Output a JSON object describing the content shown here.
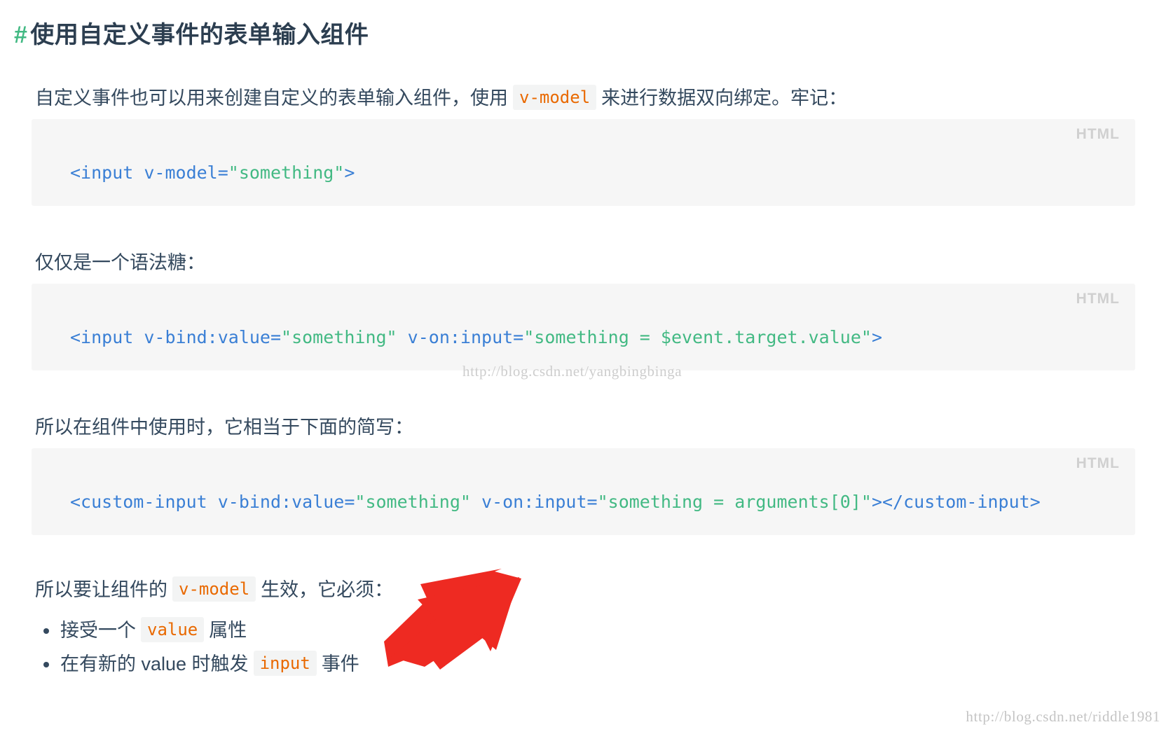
{
  "heading": {
    "anchor": "#",
    "text": "使用自定义事件的表单输入组件"
  },
  "paragraphs": {
    "p1_before": "自定义事件也可以用来创建自定义的表单输入组件，使用",
    "p1_code": "v-model",
    "p1_after": "来进行数据双向绑定。牢记：",
    "p2": "仅仅是一个语法糖：",
    "p3": "所以在组件中使用时，它相当于下面的简写：",
    "p4_before": "所以要让组件的",
    "p4_code": "v-model",
    "p4_after": "生效，它必须："
  },
  "code_blocks": [
    {
      "lang_label": "HTML",
      "tokens": [
        {
          "t": "<input",
          "c": "tag"
        },
        {
          "t": " v-model=",
          "c": "attr"
        },
        {
          "t": "\"something\"",
          "c": "str"
        },
        {
          "t": ">",
          "c": "tag"
        }
      ],
      "plain": "<input v-model=\"something\">"
    },
    {
      "lang_label": "HTML",
      "tokens": [
        {
          "t": "<input",
          "c": "tag"
        },
        {
          "t": " v-bind:value=",
          "c": "attr"
        },
        {
          "t": "\"something\"",
          "c": "str"
        },
        {
          "t": " v-on:input=",
          "c": "attr"
        },
        {
          "t": "\"something = $event.target.value\"",
          "c": "str"
        },
        {
          "t": ">",
          "c": "tag"
        }
      ],
      "plain": "<input v-bind:value=\"something\" v-on:input=\"something = $event.target.value\">"
    },
    {
      "lang_label": "HTML",
      "tokens": [
        {
          "t": "<custom-input",
          "c": "tag"
        },
        {
          "t": " v-bind:value=",
          "c": "attr"
        },
        {
          "t": "\"something\"",
          "c": "str"
        },
        {
          "t": " v-on:input=",
          "c": "attr"
        },
        {
          "t": "\"something = arguments[0]\"",
          "c": "str"
        },
        {
          "t": "></custom-input>",
          "c": "tag"
        }
      ],
      "plain": "<custom-input v-bind:value=\"something\" v-on:input=\"something = arguments[0]\"></custom-input>"
    }
  ],
  "bullets": [
    {
      "before": "接受一个",
      "code": "value",
      "after": "属性"
    },
    {
      "before": "在有新的 value 时触发",
      "code": "input",
      "after": "事件"
    }
  ],
  "watermarks": {
    "middle": "http://blog.csdn.net/yangbingbinga",
    "bottom": "http://blog.csdn.net/riddle1981"
  },
  "annotation": {
    "name": "red-arrow",
    "color": "#ee2a22",
    "points_to": "在有新的 value 时触发 input 事件"
  },
  "colors": {
    "heading": "#2c3e50",
    "anchor_green": "#42b983",
    "inline_code_orange": "#e96900",
    "code_bg": "#f6f6f6",
    "chip_bg": "#f3f4f4",
    "tag_blue": "#3a7fd5",
    "string_green": "#42b983",
    "lang_label_grey": "#d0d0d0",
    "arrow_red": "#ee2a22"
  }
}
